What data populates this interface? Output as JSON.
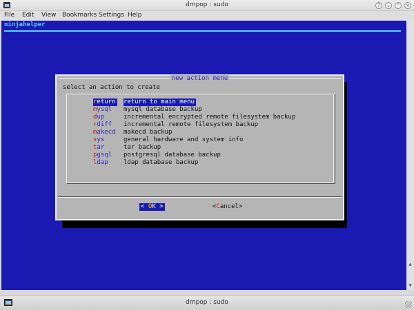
{
  "window": {
    "title": "dmpop : sudo",
    "controls": [
      "help-icon",
      "minimize-icon",
      "maximize-icon",
      "close-icon"
    ]
  },
  "menubar": {
    "items": [
      "File",
      "Edit",
      "View",
      "Bookmarks",
      "Settings",
      "Help"
    ]
  },
  "terminal": {
    "app_title": "ninjahelper",
    "dialog": {
      "title": "new action menu",
      "prompt": "select an action to create",
      "items": [
        {
          "hotkey": "r",
          "rest": "eturn",
          "description": "return to main menu",
          "selected": true
        },
        {
          "hotkey": "m",
          "rest": "ysql",
          "description": "mysql database backup",
          "selected": false
        },
        {
          "hotkey": "d",
          "rest": "up",
          "description": "incremental encrypted remote filesystem backup",
          "selected": false
        },
        {
          "hotkey": "r",
          "rest": "diff",
          "description": "incremental remote filesystem backup",
          "selected": false
        },
        {
          "hotkey": "m",
          "rest": "akecd",
          "description": "makecd backup",
          "selected": false
        },
        {
          "hotkey": "s",
          "rest": "ys",
          "description": "general hardware and system info",
          "selected": false
        },
        {
          "hotkey": "t",
          "rest": "ar",
          "description": "tar backup",
          "selected": false
        },
        {
          "hotkey": "p",
          "rest": "gsql",
          "description": "postgresql database backup",
          "selected": false
        },
        {
          "hotkey": "l",
          "rest": "dap",
          "description": "ldap database backup",
          "selected": false
        }
      ],
      "ok_button": {
        "open": "<",
        "hotkey": "O",
        "rest": "K",
        "close": ">"
      },
      "cancel_button": {
        "open": "<",
        "hotkey": "C",
        "rest": "ancel",
        "close": ">"
      }
    }
  },
  "taskbar": {
    "task_title": "dmpop : sudo"
  },
  "colors": {
    "terminal_bg": "#1a1ab2",
    "dialog_bg": "#b5b5b5",
    "accent_cyan": "#5dd0ff",
    "hotkey_red": "#c01818",
    "selected_hotkey": "#ffd700"
  }
}
